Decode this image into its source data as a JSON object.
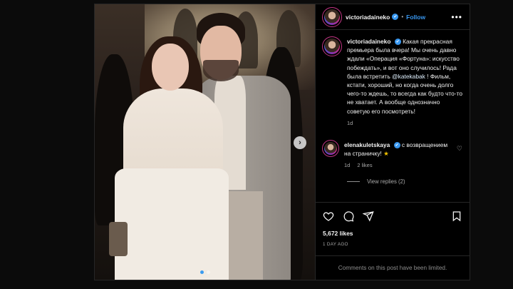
{
  "post": {
    "username": "victoriadaineko",
    "follow_label": "Follow",
    "more_label": "•••",
    "verified_mark": "✔"
  },
  "caption": {
    "username": "victoriadaineko",
    "text_before": "Какая прекрасная премьера была вчера! Мы очень давно ждали «Операция «Фортуна»: искусство побеждать», и вот оно случилось! Рада была встретить ",
    "mention": "@katekabak",
    "text_after": " ! Фильм, кстати, хороший, но когда очень долго чего-то ждешь, то всегда как будто что-то не хватает. А вообще однозначно советую его посмотреть!",
    "time": "1d"
  },
  "comment": {
    "username": "elenakuletskaya",
    "text": " с возвращением на страничку! ",
    "emoji": "★",
    "time": "1d",
    "likes": "2 likes",
    "view_replies": "View replies (2)"
  },
  "actions": {
    "likes": "5,672 likes",
    "ago": "1 DAY AGO",
    "limited_note": "Comments on this post have been limited."
  },
  "carousel": {
    "next_glyph": "›",
    "slide_count": 2,
    "active_index": 0
  },
  "icons": {
    "heart": "heart-icon",
    "comment": "comment-icon",
    "share": "share-icon",
    "save": "bookmark-icon"
  },
  "colors": {
    "accent": "#3897f0",
    "background": "#000000"
  }
}
